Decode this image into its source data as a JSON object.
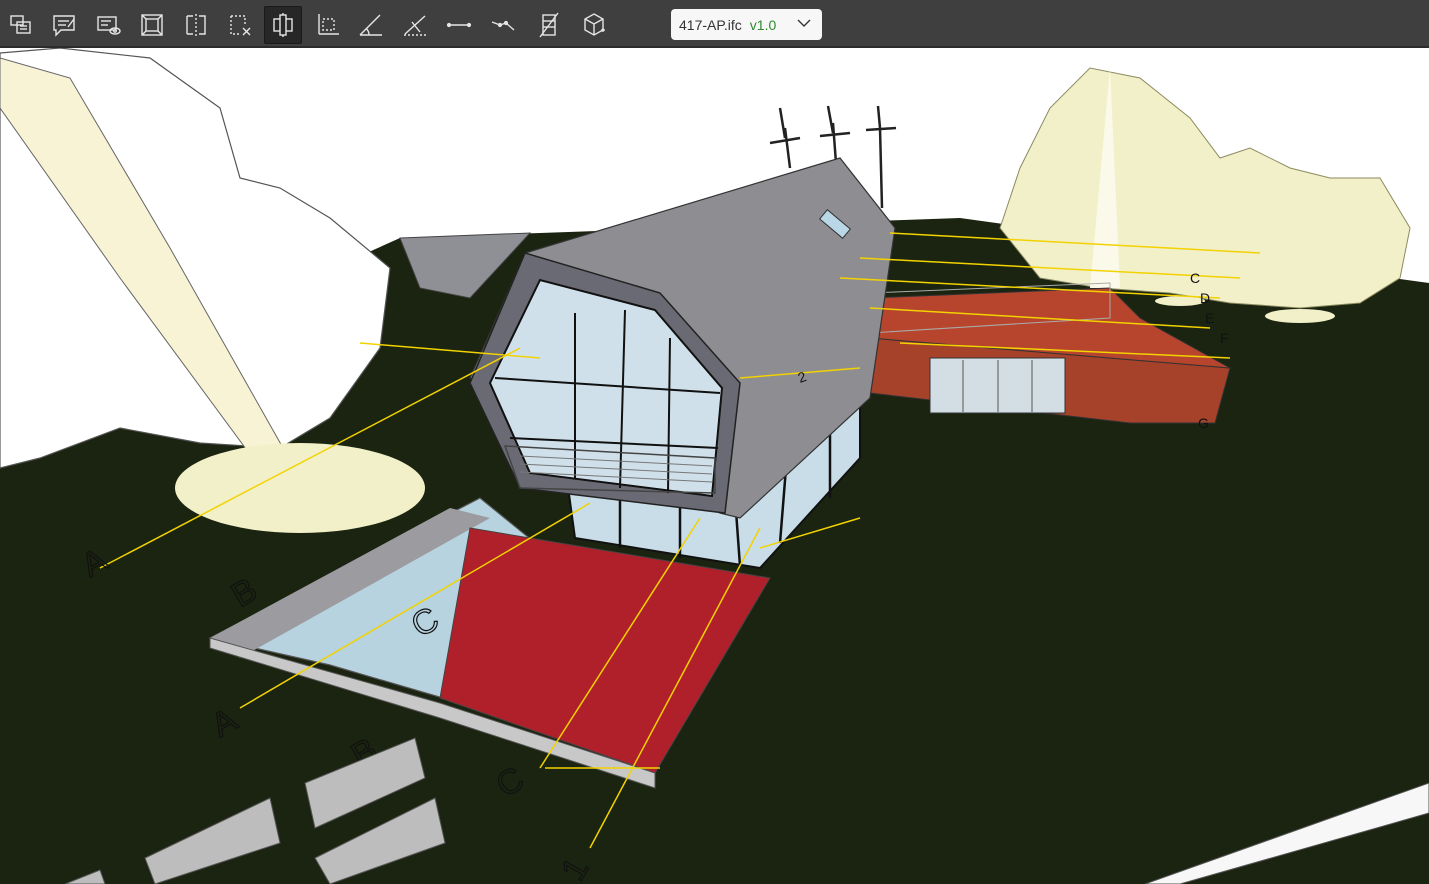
{
  "toolbar": {
    "tools": [
      {
        "name": "bcf-topics-icon"
      },
      {
        "name": "comment-edit-icon"
      },
      {
        "name": "view-comments-icon"
      },
      {
        "name": "model-tree-icon"
      },
      {
        "name": "section-box-icon"
      },
      {
        "name": "clear-section-icon"
      },
      {
        "name": "clipping-plane-icon",
        "active": true
      },
      {
        "name": "area-measure-icon"
      },
      {
        "name": "angle-measure-icon"
      },
      {
        "name": "slope-measure-icon"
      },
      {
        "name": "distance-measure-icon"
      },
      {
        "name": "point-measure-icon"
      },
      {
        "name": "storeys-icon"
      },
      {
        "name": "3d-cube-icon"
      }
    ]
  },
  "file_selector": {
    "filename": "417-AP.ifc",
    "version": "v1.0"
  },
  "viewport": {
    "grid_labels": [
      "A",
      "B",
      "C",
      "A",
      "B",
      "C",
      "1",
      "2",
      "C",
      "D",
      "E",
      "F",
      "G"
    ],
    "colors": {
      "ground": "#1b2410",
      "roof": "#8e8e92",
      "annex": "#a6422a",
      "pad_red": "#b0202a",
      "pool": "#b7d3df",
      "grid_line": "#f2d200",
      "tree_fill": "#f2f0c9"
    }
  }
}
